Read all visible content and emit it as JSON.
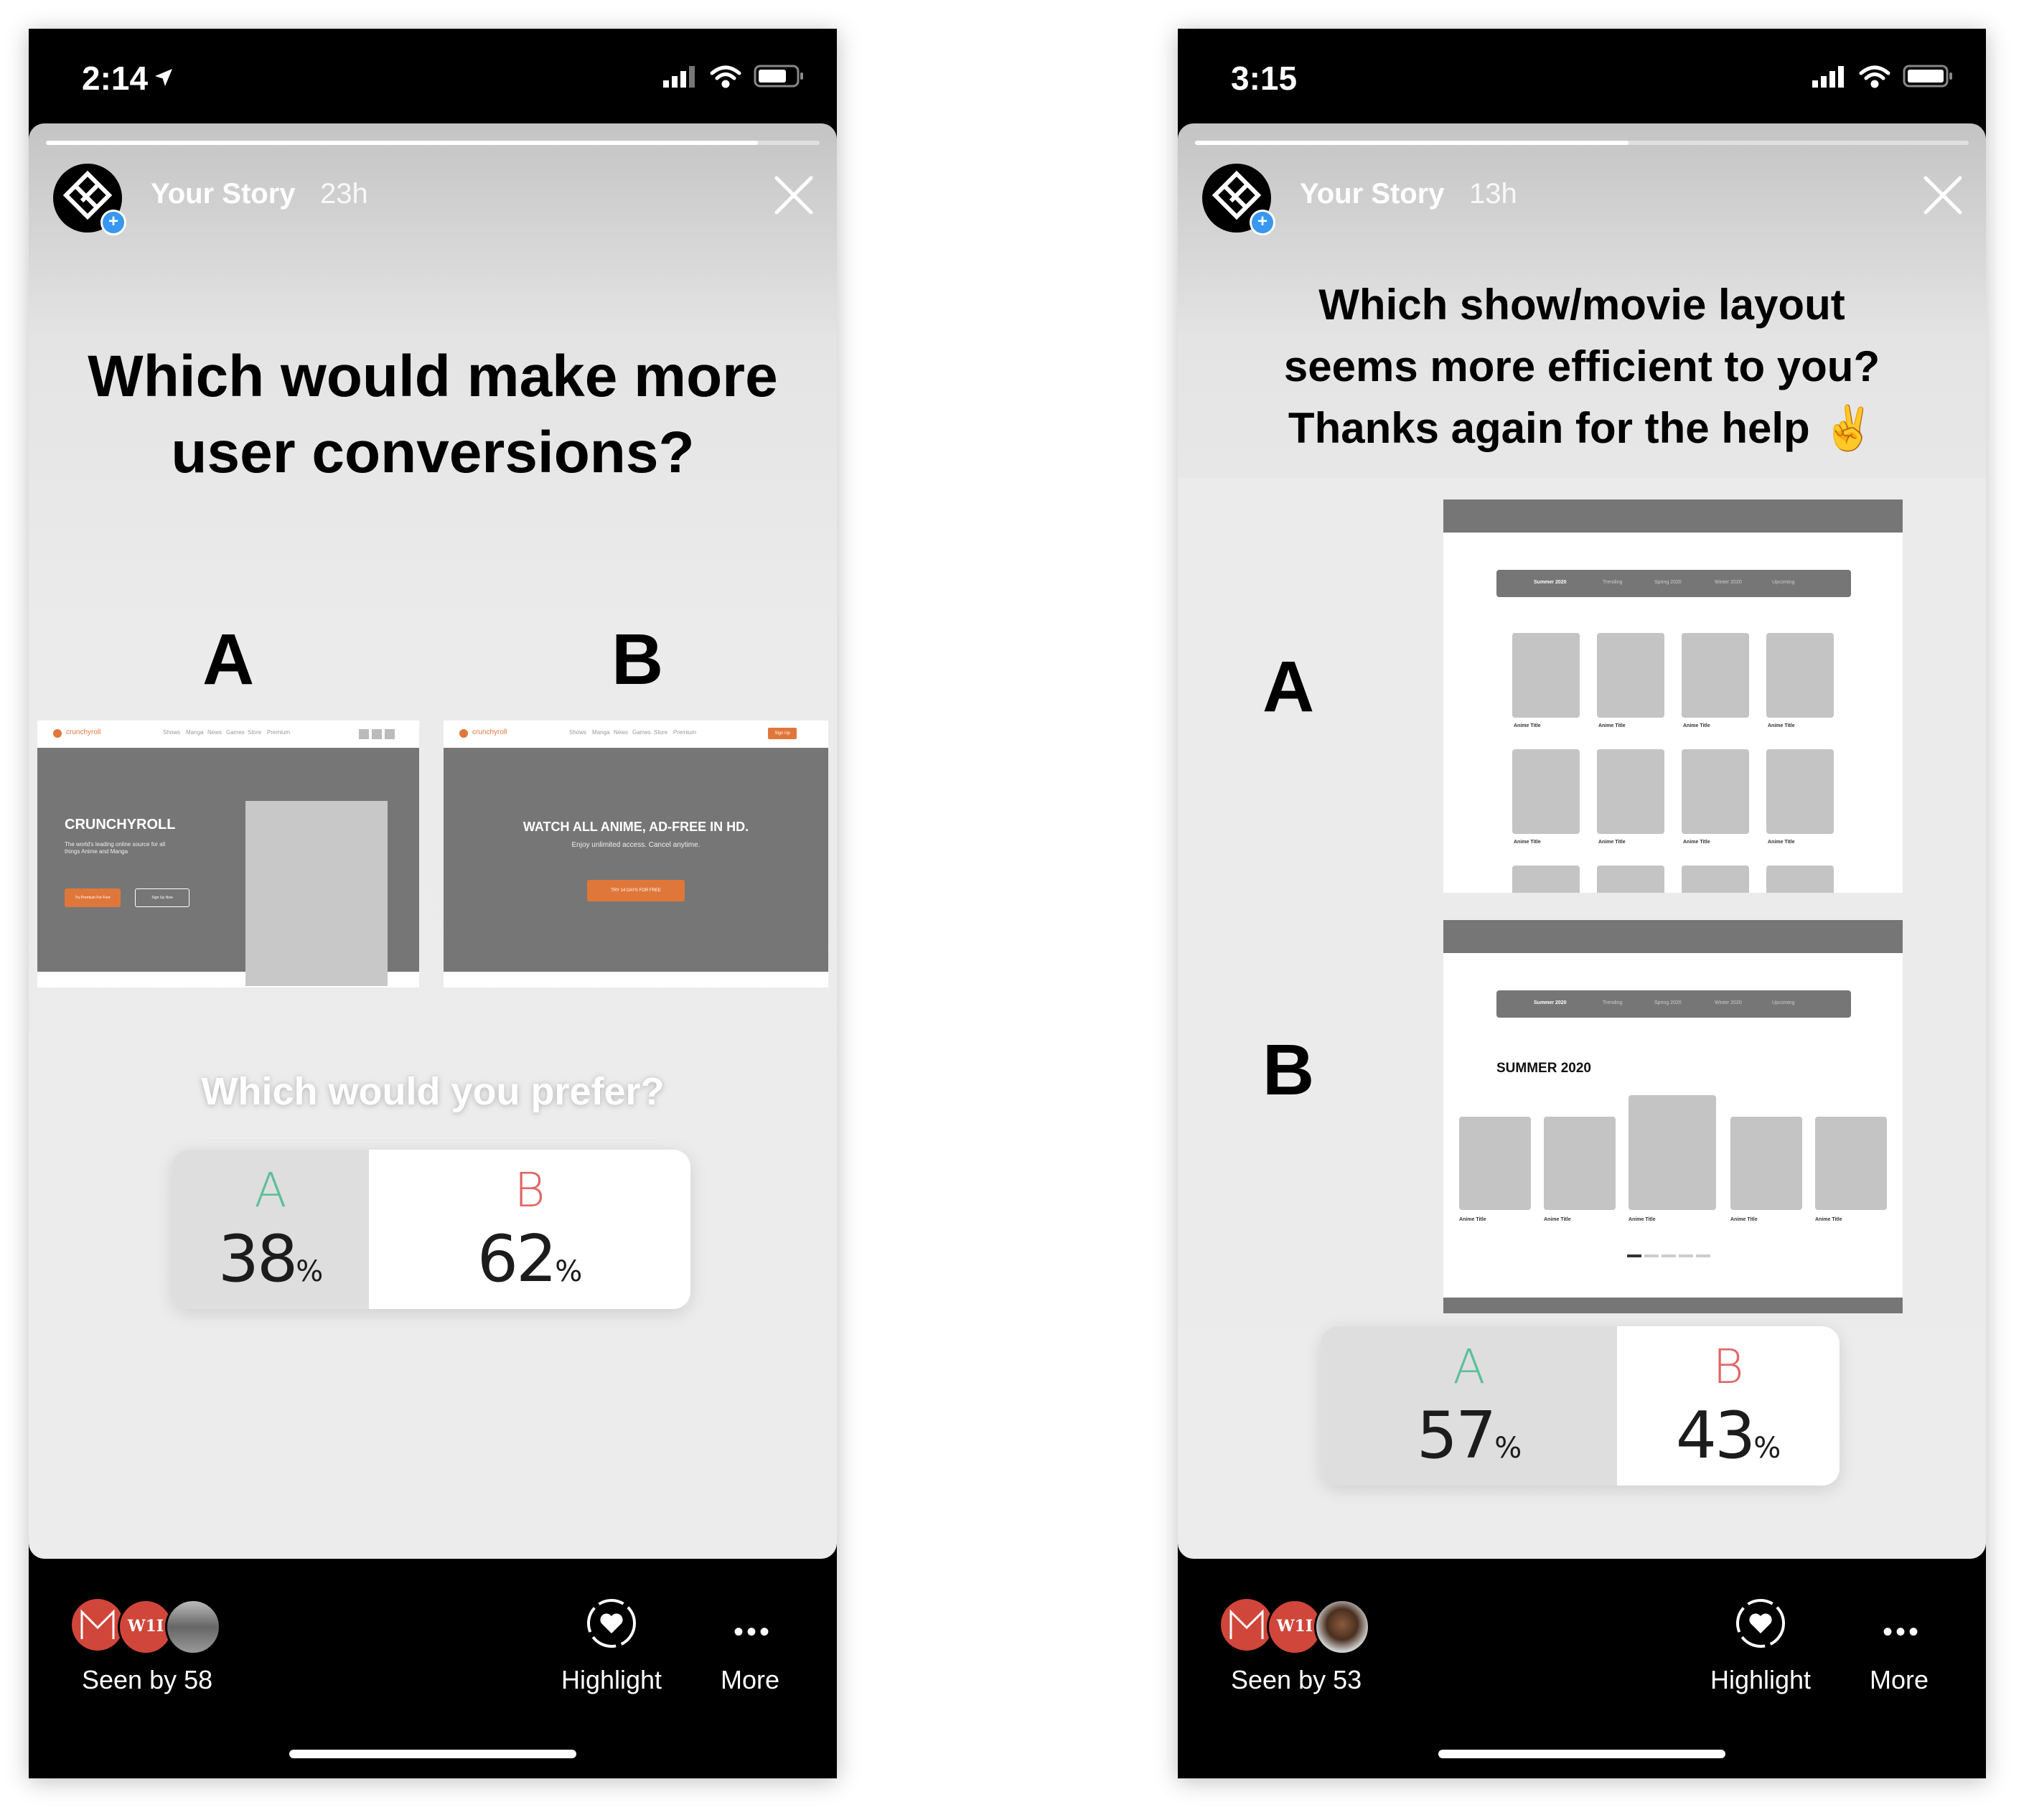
{
  "left": {
    "status": {
      "time": "2:14"
    },
    "story": {
      "name": "Your Story",
      "age": "23h",
      "question": [
        "Which would make more",
        "user conversions?"
      ],
      "option_a_label": "A",
      "option_b_label": "B",
      "preview_a": {
        "logo": "crunchyroll",
        "nav": [
          "Shows",
          "Manga",
          "News",
          "Games",
          "Store",
          "Premium"
        ],
        "headline": "CRUNCHYROLL",
        "sub": [
          "The world's leading online source for all",
          "things Anime and Manga"
        ],
        "btn1": "Try Premium For Free",
        "btn2": "Sign Up Now"
      },
      "preview_b": {
        "logo": "crunchyroll",
        "nav": [
          "Shows",
          "Manga",
          "News",
          "Games",
          "Store",
          "Premium"
        ],
        "nav_btn": "Sign Up",
        "headline": "WATCH ALL ANIME, AD-FREE IN HD.",
        "sub": "Enjoy unlimited access. Cancel anytime.",
        "cta": "TRY 14 DAYS FOR FREE"
      },
      "poll": {
        "question": "Which would you prefer?",
        "a": {
          "letter": "A",
          "value": "38",
          "unit": "%",
          "fraction": 0.38
        },
        "b": {
          "letter": "B",
          "value": "62",
          "unit": "%",
          "fraction": 0.62
        }
      },
      "progress": 0.92
    },
    "bottom": {
      "seen": "Seen by 58",
      "highlight": "Highlight",
      "more": "More",
      "viewer_badge": "W1I"
    }
  },
  "right": {
    "status": {
      "time": "3:15"
    },
    "story": {
      "name": "Your Story",
      "age": "13h",
      "question": [
        "Which show/movie layout",
        "seems more efficient to you?",
        "Thanks again for the help ✌"
      ],
      "option_a_label": "A",
      "option_b_label": "B",
      "tabs": [
        "Summer 2020",
        "Trending",
        "Spring 2020",
        "Winter 2020",
        "Upcoming"
      ],
      "card_title": "Anime Title",
      "section_title": "SUMMER 2020",
      "poll": {
        "a": {
          "letter": "A",
          "value": "57",
          "unit": "%",
          "fraction": 0.57
        },
        "b": {
          "letter": "B",
          "value": "43",
          "unit": "%",
          "fraction": 0.43
        }
      },
      "progress": 0.56
    },
    "bottom": {
      "seen": "Seen by 53",
      "highlight": "Highlight",
      "more": "More",
      "viewer_badge": "W1I"
    }
  },
  "colors": {
    "option_a": "#5bbf9a",
    "option_b": "#e06666",
    "accent_orange": "#e0773a",
    "mock_gray": "#767676",
    "card_gray": "#c4c4c4",
    "viewer_red": "#d0463a",
    "plus_blue": "#3897f0"
  },
  "icons": [
    "location-arrow-icon",
    "signal-icon",
    "wifi-icon",
    "battery-icon",
    "close-icon",
    "plus-icon",
    "highlight-heart-icon",
    "more-dots-icon"
  ]
}
